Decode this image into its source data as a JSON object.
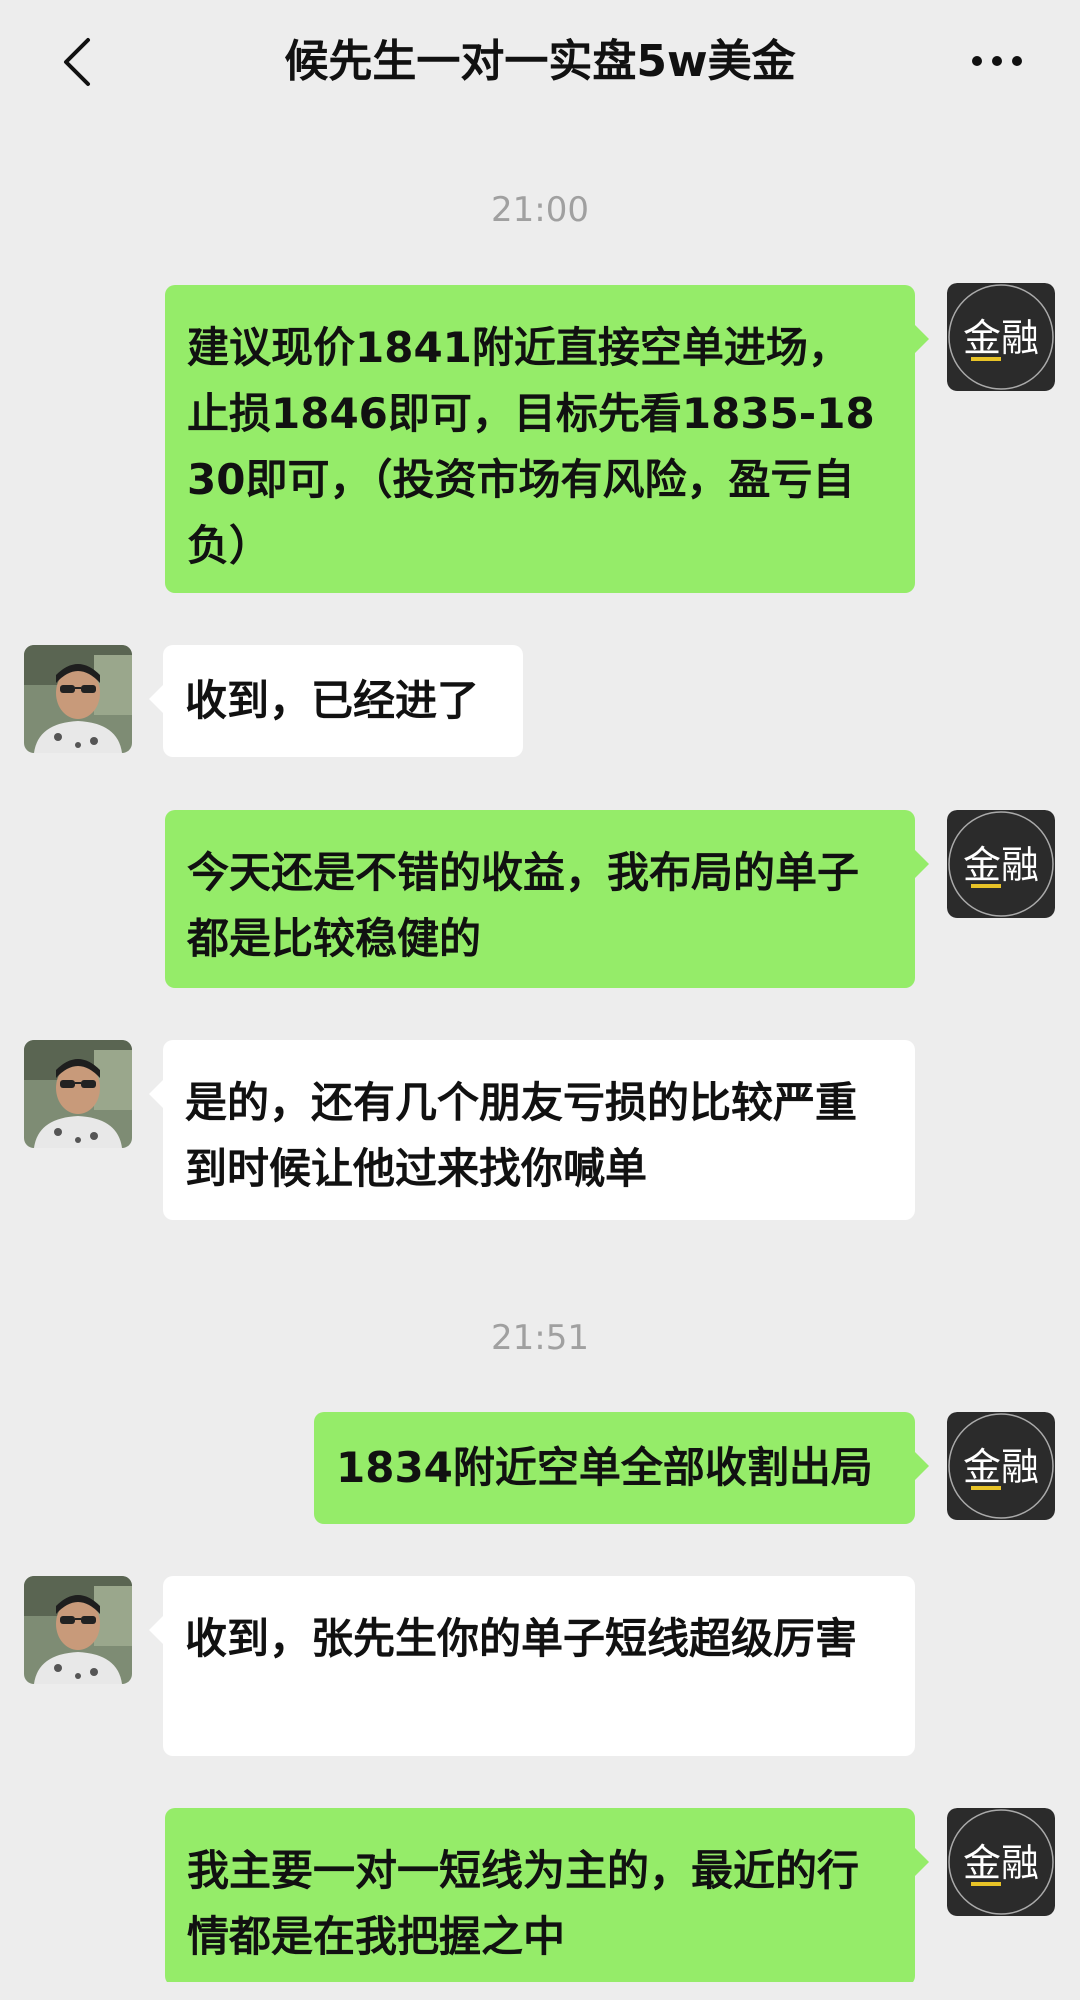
{
  "header": {
    "title": "候先生一对一实盘5w美金"
  },
  "brand_avatar_text": "金融",
  "messages": [
    {
      "type": "time",
      "text": "21:00"
    },
    {
      "type": "out",
      "text": "建议现价1841附近直接空单进场，止损1846即可，目标先看1835-1830即可，（投资市场有风险，盈亏自负）"
    },
    {
      "type": "in",
      "text": "收到，已经进了"
    },
    {
      "type": "out",
      "text": "今天还是不错的收益，我布局的单子都是比较稳健的"
    },
    {
      "type": "in",
      "text": "是的，还有几个朋友亏损的比较严重到时候让他过来找你喊单"
    },
    {
      "type": "time",
      "text": "21:51"
    },
    {
      "type": "out",
      "text": "1834附近空单全部收割出局"
    },
    {
      "type": "in",
      "text": "收到，张先生你的单子短线超级厉害"
    },
    {
      "type": "out",
      "text": "我主要一对一短线为主的，最近的行情都是在我把握之中"
    }
  ],
  "colors": {
    "background": "#ededed",
    "outgoing_bubble": "#95ec69",
    "incoming_bubble": "#ffffff",
    "timestamp_text": "#a0a0a0",
    "brand_avatar_bg": "#2b2b2b",
    "brand_avatar_text_accent": "#e8c327"
  },
  "icons": {
    "back": "chevron-left-icon",
    "more": "more-dots-icon"
  }
}
